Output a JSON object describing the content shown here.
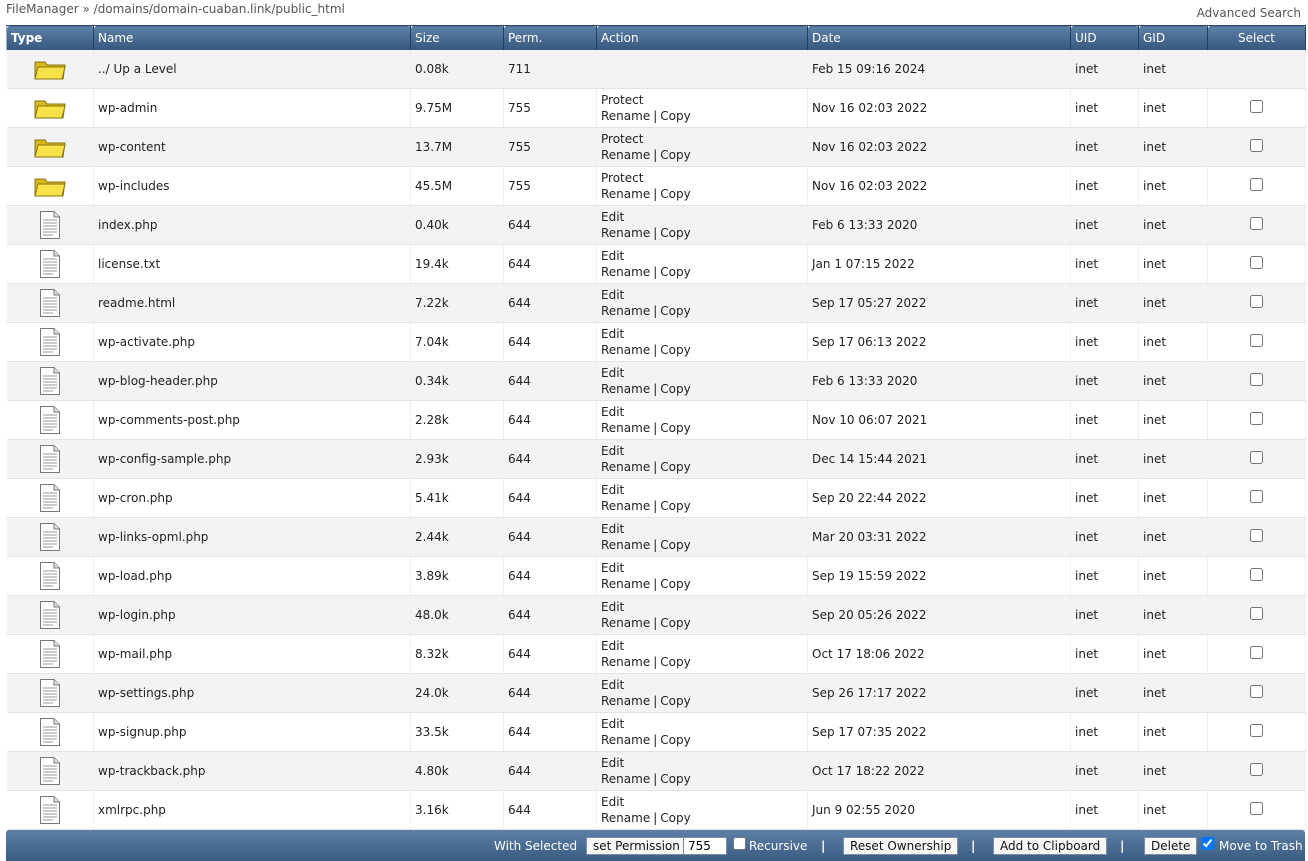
{
  "breadcrumb": "FileManager » /domains/domain-cuaban.link/public_html",
  "advanced_search": "Advanced Search",
  "columns": {
    "type": "Type",
    "name": "Name",
    "size": "Size",
    "perm": "Perm.",
    "action": "Action",
    "date": "Date",
    "uid": "UID",
    "gid": "GID",
    "select": "Select"
  },
  "action_labels": {
    "protect": "Protect",
    "edit": "Edit",
    "rename": "Rename",
    "copy": "Copy",
    "separator": "|"
  },
  "rows": [
    {
      "kind": "folder",
      "name": "../ Up a Level",
      "size": "0.08k",
      "perm": "711",
      "date": "Feb 15 09:16 2024",
      "uid": "inet",
      "gid": "inet",
      "actions": false
    },
    {
      "kind": "folder",
      "name": "wp-admin",
      "size": "9.75M",
      "perm": "755",
      "date": "Nov 16 02:03 2022",
      "uid": "inet",
      "gid": "inet",
      "actions": true
    },
    {
      "kind": "folder",
      "name": "wp-content",
      "size": "13.7M",
      "perm": "755",
      "date": "Nov 16 02:03 2022",
      "uid": "inet",
      "gid": "inet",
      "actions": true
    },
    {
      "kind": "folder",
      "name": "wp-includes",
      "size": "45.5M",
      "perm": "755",
      "date": "Nov 16 02:03 2022",
      "uid": "inet",
      "gid": "inet",
      "actions": true
    },
    {
      "kind": "file",
      "name": "index.php",
      "size": "0.40k",
      "perm": "644",
      "date": "Feb 6 13:33 2020",
      "uid": "inet",
      "gid": "inet",
      "actions": true
    },
    {
      "kind": "file",
      "name": "license.txt",
      "size": "19.4k",
      "perm": "644",
      "date": "Jan 1 07:15 2022",
      "uid": "inet",
      "gid": "inet",
      "actions": true
    },
    {
      "kind": "file",
      "name": "readme.html",
      "size": "7.22k",
      "perm": "644",
      "date": "Sep 17 05:27 2022",
      "uid": "inet",
      "gid": "inet",
      "actions": true
    },
    {
      "kind": "file",
      "name": "wp-activate.php",
      "size": "7.04k",
      "perm": "644",
      "date": "Sep 17 06:13 2022",
      "uid": "inet",
      "gid": "inet",
      "actions": true
    },
    {
      "kind": "file",
      "name": "wp-blog-header.php",
      "size": "0.34k",
      "perm": "644",
      "date": "Feb 6 13:33 2020",
      "uid": "inet",
      "gid": "inet",
      "actions": true
    },
    {
      "kind": "file",
      "name": "wp-comments-post.php",
      "size": "2.28k",
      "perm": "644",
      "date": "Nov 10 06:07 2021",
      "uid": "inet",
      "gid": "inet",
      "actions": true
    },
    {
      "kind": "file",
      "name": "wp-config-sample.php",
      "size": "2.93k",
      "perm": "644",
      "date": "Dec 14 15:44 2021",
      "uid": "inet",
      "gid": "inet",
      "actions": true
    },
    {
      "kind": "file",
      "name": "wp-cron.php",
      "size": "5.41k",
      "perm": "644",
      "date": "Sep 20 22:44 2022",
      "uid": "inet",
      "gid": "inet",
      "actions": true
    },
    {
      "kind": "file",
      "name": "wp-links-opml.php",
      "size": "2.44k",
      "perm": "644",
      "date": "Mar 20 03:31 2022",
      "uid": "inet",
      "gid": "inet",
      "actions": true
    },
    {
      "kind": "file",
      "name": "wp-load.php",
      "size": "3.89k",
      "perm": "644",
      "date": "Sep 19 15:59 2022",
      "uid": "inet",
      "gid": "inet",
      "actions": true
    },
    {
      "kind": "file",
      "name": "wp-login.php",
      "size": "48.0k",
      "perm": "644",
      "date": "Sep 20 05:26 2022",
      "uid": "inet",
      "gid": "inet",
      "actions": true
    },
    {
      "kind": "file",
      "name": "wp-mail.php",
      "size": "8.32k",
      "perm": "644",
      "date": "Oct 17 18:06 2022",
      "uid": "inet",
      "gid": "inet",
      "actions": true
    },
    {
      "kind": "file",
      "name": "wp-settings.php",
      "size": "24.0k",
      "perm": "644",
      "date": "Sep 26 17:17 2022",
      "uid": "inet",
      "gid": "inet",
      "actions": true
    },
    {
      "kind": "file",
      "name": "wp-signup.php",
      "size": "33.5k",
      "perm": "644",
      "date": "Sep 17 07:35 2022",
      "uid": "inet",
      "gid": "inet",
      "actions": true
    },
    {
      "kind": "file",
      "name": "wp-trackback.php",
      "size": "4.80k",
      "perm": "644",
      "date": "Oct 17 18:22 2022",
      "uid": "inet",
      "gid": "inet",
      "actions": true
    },
    {
      "kind": "file",
      "name": "xmlrpc.php",
      "size": "3.16k",
      "perm": "644",
      "date": "Jun 9 02:55 2020",
      "uid": "inet",
      "gid": "inet",
      "actions": true
    }
  ],
  "footer": {
    "with_selected": "With Selected",
    "set_permission": "set Permission",
    "permission_value": "755",
    "recursive": "Recursive",
    "recursive_checked": false,
    "reset_ownership": "Reset Ownership",
    "add_to_clipboard": "Add to Clipboard",
    "delete": "Delete",
    "move_to_trash": "Move to Trash",
    "move_to_trash_checked": true,
    "separator": "|"
  },
  "icons": {
    "folder": "folder-icon",
    "file": "file-icon"
  },
  "colors": {
    "header_top": "#5d80a6",
    "header_bottom": "#36577d",
    "folder_fill": "#f7e24a",
    "row_alt": "#f3f3f3"
  }
}
